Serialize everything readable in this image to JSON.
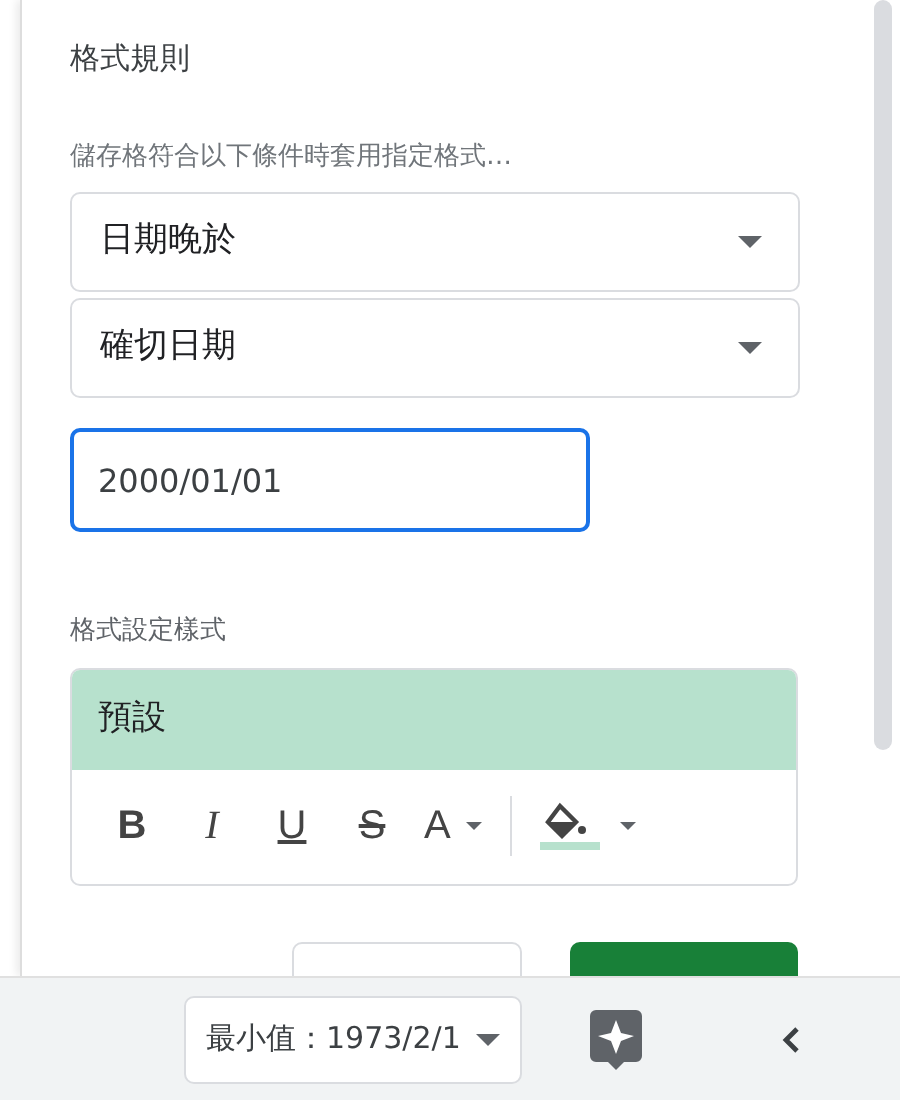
{
  "panel": {
    "title": "格式規則",
    "condition_label": "儲存格符合以下條件時套用指定格式…",
    "dropdowns": [
      {
        "value": "日期晚於"
      },
      {
        "value": "確切日期"
      }
    ],
    "date_input": {
      "value": "2000/01/01",
      "focused": true
    },
    "style_label": "格式設定樣式",
    "preview": {
      "text": "預設"
    },
    "toolbar": [
      {
        "kind": "bold",
        "glyph": "B"
      },
      {
        "kind": "italic",
        "glyph": "I"
      },
      {
        "kind": "underline",
        "glyph": "U"
      },
      {
        "kind": "strike",
        "glyph": "S"
      },
      {
        "kind": "text_color",
        "glyph": "A"
      },
      {
        "kind": "fill_color"
      }
    ]
  },
  "status_bar": {
    "summary": "最小值：1973/2/1"
  }
}
